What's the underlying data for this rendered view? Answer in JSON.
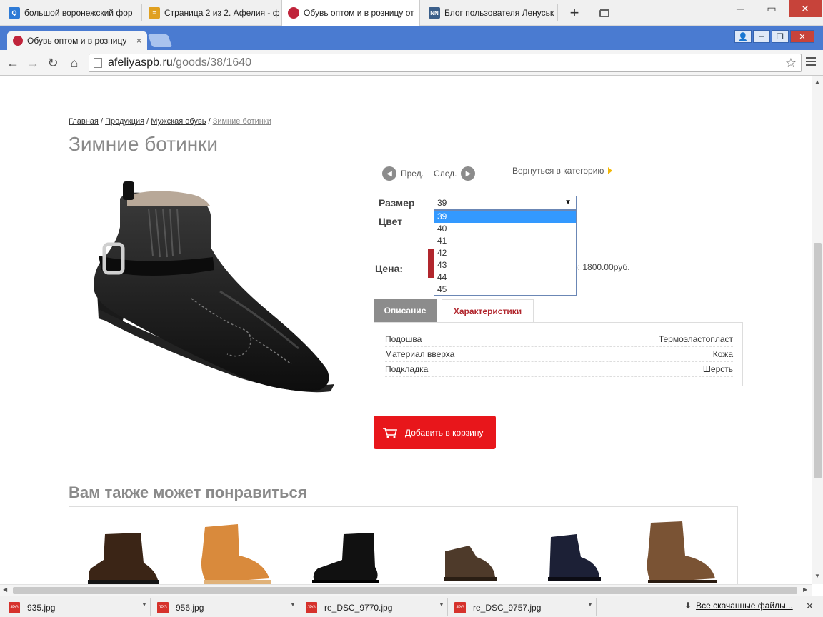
{
  "taskbar_tabs": [
    {
      "label": "большой воронежский фор",
      "color": "#2f7bd6",
      "glyph": "Q"
    },
    {
      "label": "Страница 2 из 2. Афелия - ф",
      "color": "#e0a020",
      "glyph": "≡"
    },
    {
      "label": "Обувь оптом и в розницу от",
      "color": "#c0243b",
      "glyph": ""
    },
    {
      "label": "Блог пользователя Ленуська",
      "color": "#3b5f8a",
      "glyph": "NN"
    }
  ],
  "browser_tab": {
    "title": "Обувь оптом и в розницу",
    "close": "×"
  },
  "address": {
    "host": "afeliyaspb.ru",
    "path": "/goods/38/1640"
  },
  "breadcrumb": {
    "items": [
      "Главная",
      "Продукция",
      "Мужская обувь"
    ],
    "current": "Зимние ботинки",
    "sep": "/"
  },
  "page_title": "Зимние ботинки",
  "nav": {
    "prev": "Пред.",
    "next": "След.",
    "back_to_category": "Вернуться в категорию"
  },
  "size": {
    "label": "Размер",
    "selected": "39",
    "options": [
      "39",
      "40",
      "41",
      "42",
      "43",
      "44",
      "45"
    ]
  },
  "color_label": "Цвет",
  "price": {
    "label": "Цена:",
    "text": "р: 1800.00руб."
  },
  "tabs": {
    "description": "Описание",
    "specs": "Характеристики"
  },
  "specs": [
    {
      "name": "Подошва",
      "value": "Термоэластопласт"
    },
    {
      "name": "Материал вверха",
      "value": "Кожа"
    },
    {
      "name": "Подкладка",
      "value": "Шерсть"
    }
  ],
  "cart_button": "Добавить в корзину",
  "also_like": "Вам также может понравиться",
  "downloads": [
    {
      "name": "935.jpg",
      "icon": "JPG"
    },
    {
      "name": "956.jpg",
      "icon": "JPG"
    },
    {
      "name": "re_DSC_9770.jpg",
      "icon": "JPG"
    },
    {
      "name": "re_DSC_9757.jpg",
      "icon": "JPG"
    }
  ],
  "all_downloads": "Все скачанные файлы...",
  "colors": {
    "accent_red": "#e8161b",
    "dark_red": "#b1262d",
    "chrome_blue": "#4a7bd1",
    "selected_option": "#3399ff"
  }
}
